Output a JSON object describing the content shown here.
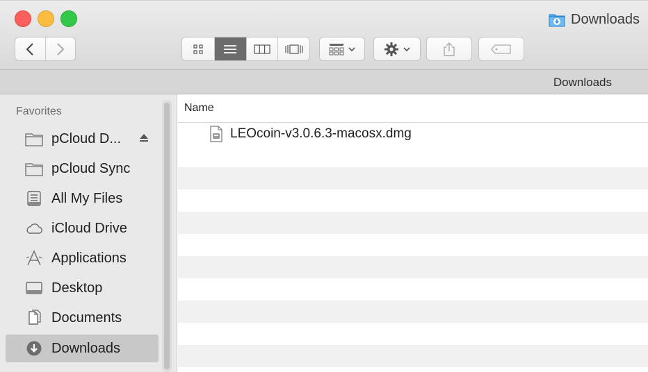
{
  "window": {
    "title": "Downloads"
  },
  "toolbar": {
    "back_icon": "chevron-left-icon",
    "forward_icon": "chevron-right-icon",
    "views": [
      "icon-view-icon",
      "list-view-icon",
      "column-view-icon",
      "cover-flow-icon"
    ],
    "active_view": "list-view-icon",
    "arrange_icon": "arrange-grid-icon",
    "action_icon": "gear-icon",
    "share_icon": "share-icon",
    "tags_icon": "tag-icon"
  },
  "pathbar": {
    "label": "Downloads"
  },
  "sidebar": {
    "heading": "Favorites",
    "items": [
      {
        "label": "pCloud D...",
        "icon": "folder-icon",
        "eject": true
      },
      {
        "label": "pCloud Sync",
        "icon": "folder-icon"
      },
      {
        "label": "All My Files",
        "icon": "all-files-icon"
      },
      {
        "label": "iCloud Drive",
        "icon": "cloud-icon"
      },
      {
        "label": "Applications",
        "icon": "applications-icon"
      },
      {
        "label": "Desktop",
        "icon": "desktop-icon"
      },
      {
        "label": "Documents",
        "icon": "documents-icon"
      },
      {
        "label": "Downloads",
        "icon": "downloads-icon",
        "selected": true
      }
    ]
  },
  "file_list": {
    "column_header": "Name",
    "files": [
      {
        "name": "LEOcoin-v3.0.6.3-macosx.dmg",
        "icon": "disk-image-icon"
      }
    ]
  },
  "colors": {
    "close": "#fc605c",
    "minimize": "#fdbc40",
    "maximize": "#34c84a",
    "accent": "#2e8de6",
    "selected_sidebar": "#c8c8c8",
    "row_stripe": "#f1f1f1"
  }
}
